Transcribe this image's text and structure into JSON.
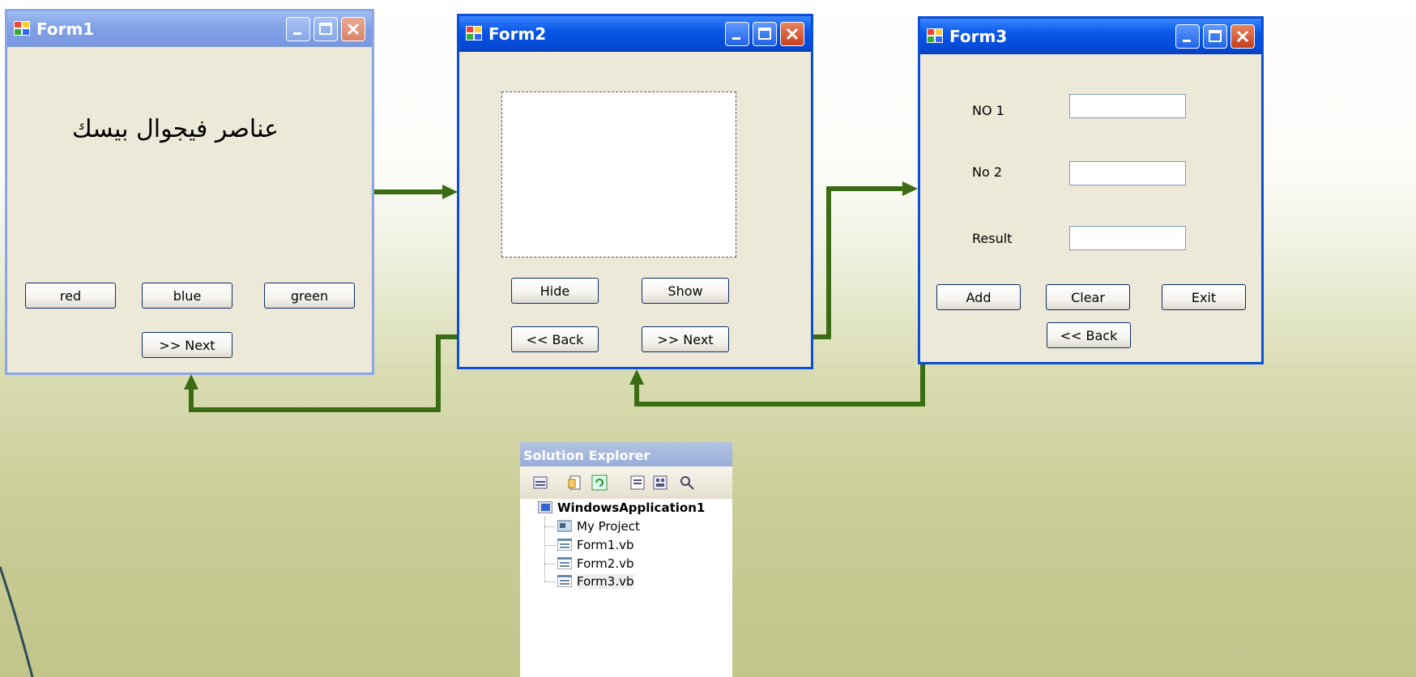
{
  "form1": {
    "title": "Form1",
    "heading": "عناصر فيجوال بيسك",
    "buttons": {
      "red": "red",
      "blue": "blue",
      "green": "green",
      "next": ">> Next"
    }
  },
  "form2": {
    "title": "Form2",
    "buttons": {
      "hide": "Hide",
      "show": "Show",
      "back": "<< Back",
      "next": ">> Next"
    }
  },
  "form3": {
    "title": "Form3",
    "labels": {
      "no1": "NO 1",
      "no2": "No 2",
      "result": "Result"
    },
    "buttons": {
      "add": "Add",
      "clear": "Clear",
      "exit": "Exit",
      "back": "<< Back"
    }
  },
  "solution_explorer": {
    "title": "Solution Explorer",
    "root": "WindowsApplication1",
    "items": [
      "My Project",
      "Form1.vb",
      "Form2.vb",
      "Form3.vb"
    ]
  },
  "colors": {
    "arrow": "#3b6b12",
    "title_active": "#0a58e8",
    "title_inactive": "#7f9fe6"
  }
}
